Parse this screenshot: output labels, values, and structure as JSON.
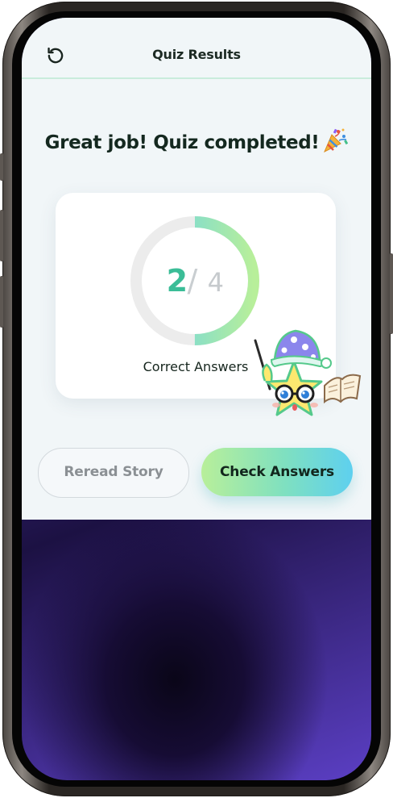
{
  "header": {
    "title": "Quiz Results",
    "back_icon": "rotate-ccw-icon"
  },
  "main": {
    "headline": "Great job! Quiz completed!",
    "headline_icon": "party-popper-icon"
  },
  "score_card": {
    "correct": "2",
    "separator": "/",
    "total": "4",
    "caption": "Correct Answers",
    "progress_fraction": 0.5,
    "ring_gradient": [
      "#5ed0ef",
      "#b8ef9a"
    ],
    "track_color": "#ececec",
    "number_color": "#3bbd97"
  },
  "mascot": {
    "icon": "star-teacher-mascot-icon"
  },
  "buttons": {
    "reread_label": "Reread Story",
    "check_label": "Check Answers"
  },
  "colors": {
    "app_background": "#f1f6f8",
    "divider": "#c9ecdc",
    "text_dark": "#14281f",
    "button_gradient": [
      "#b8ef9a",
      "#5ed0ef"
    ]
  }
}
